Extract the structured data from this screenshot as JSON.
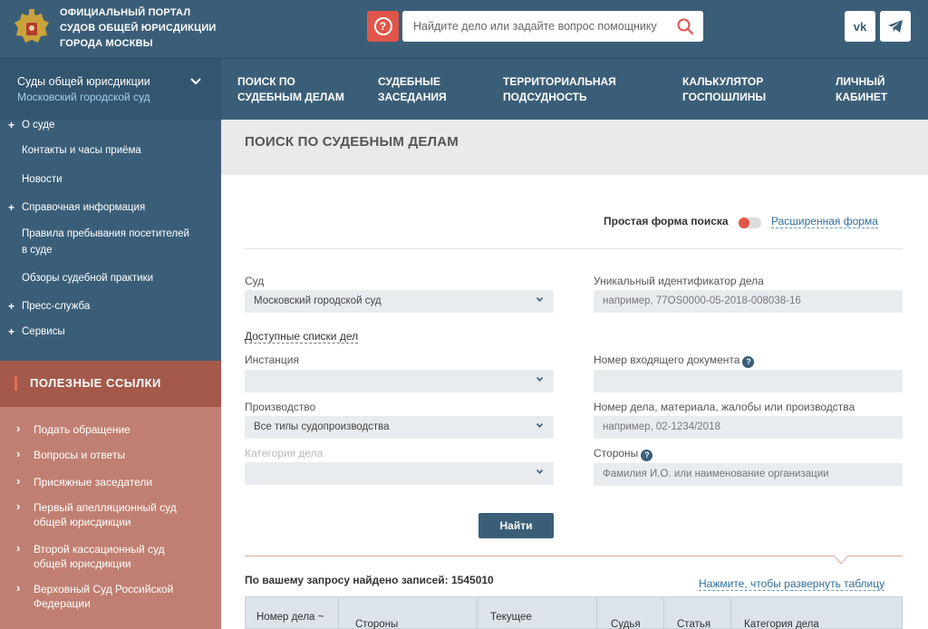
{
  "header": {
    "title": "Официальный портал судов общей юрисдикции города Москвы",
    "title_lines": [
      "Официальный портал",
      "судов общей юрисдикции",
      "города Москвы"
    ],
    "help_icon": "question-icon",
    "search_placeholder": "Найдите дело или задайте вопрос помощнику",
    "search_icon": "search-icon",
    "social": [
      {
        "name": "vk",
        "label": "vk"
      },
      {
        "name": "telegram",
        "label": "telegram"
      }
    ]
  },
  "nav": {
    "courts_line1": "Суды общей юрисдикции",
    "courts_line2": "Московский городской суд",
    "items": [
      {
        "line1": "Поиск по",
        "line2": "судебным делам"
      },
      {
        "line1": "Судебные",
        "line2": "заседания"
      },
      {
        "line1": "Территориальная",
        "line2": "подсудность"
      },
      {
        "line1": "Калькулятор",
        "line2": "госпошлины"
      },
      {
        "line1": "Личный",
        "line2": "кабинет"
      }
    ]
  },
  "sidebar": {
    "items": [
      {
        "label": "О суде",
        "plus": true
      },
      {
        "label": "Контакты и часы приёма",
        "plus": false
      },
      {
        "label": "Новости",
        "plus": false
      },
      {
        "label": "Справочная информация",
        "plus": true
      },
      {
        "label": "Правила пребывания посетителей в суде",
        "line1": "Правила пребывания посетителей",
        "line2": "в суде",
        "plus": false
      },
      {
        "label": "Обзоры судебной практики",
        "plus": false
      },
      {
        "label": "Пресс-служба",
        "plus": true
      },
      {
        "label": "Сервисы",
        "plus": true
      }
    ],
    "useful_links_title": "Полезные ссылки",
    "links": [
      {
        "line1": "Подать обращение",
        "line2": ""
      },
      {
        "line1": "Вопросы и ответы",
        "line2": ""
      },
      {
        "line1": "Присяжные заседатели",
        "line2": ""
      },
      {
        "line1": "Первый апелляционный суд",
        "line2": "общей юрисдикции"
      },
      {
        "line1": "Второй кассационный суд",
        "line2": "общей юрисдикции"
      },
      {
        "line1": "Верховный Суд Российской",
        "line2": "Федерации"
      }
    ]
  },
  "main": {
    "title": "Поиск по судебным делам",
    "simple_form": "Простая форма поиска",
    "extended_form": "Расширенная форма",
    "fields": {
      "court_label": "Суд",
      "court_value": "Московский городской суд",
      "uid_label": "Уникальный идентификатор дела",
      "uid_placeholder": "например, 77OS0000-05-2018-008038-16",
      "lists_link": "Доступные списки дел",
      "instance_label": "Инстанция",
      "instance_value": "",
      "incoming_label": "Номер входящего документа",
      "incoming_value": "",
      "production_label": "Производство",
      "production_value": "Все типы судопроизводства",
      "case_number_label": "Номер дела, материала, жалобы или производства",
      "case_number_placeholder": "например, 02-1234/2018",
      "category_label": "Категория дела",
      "category_value": "",
      "parties_label": "Стороны",
      "parties_placeholder": "Фамилия И.О. или наименование организации"
    },
    "find_button": "Найти",
    "found_text": "По вашему запросу найдено записей: 1545010",
    "expand_link": "Нажмите, чтобы развернуть таблицу",
    "table_headers": [
      {
        "line1": "Номер дела ~",
        "line2": ""
      },
      {
        "line1": "Стороны",
        "line2": ""
      },
      {
        "line1": "Текущее",
        "line2": ""
      },
      {
        "line1": "Судья",
        "line2": ""
      },
      {
        "line1": "Статья",
        "line2": ""
      },
      {
        "line1": "Категория дела",
        "line2": ""
      }
    ]
  },
  "colors": {
    "header_bg": "#3b5e78",
    "accent_red": "#e0564a",
    "links_bg": "#c07f72",
    "links_head_bg": "#a4594a"
  }
}
